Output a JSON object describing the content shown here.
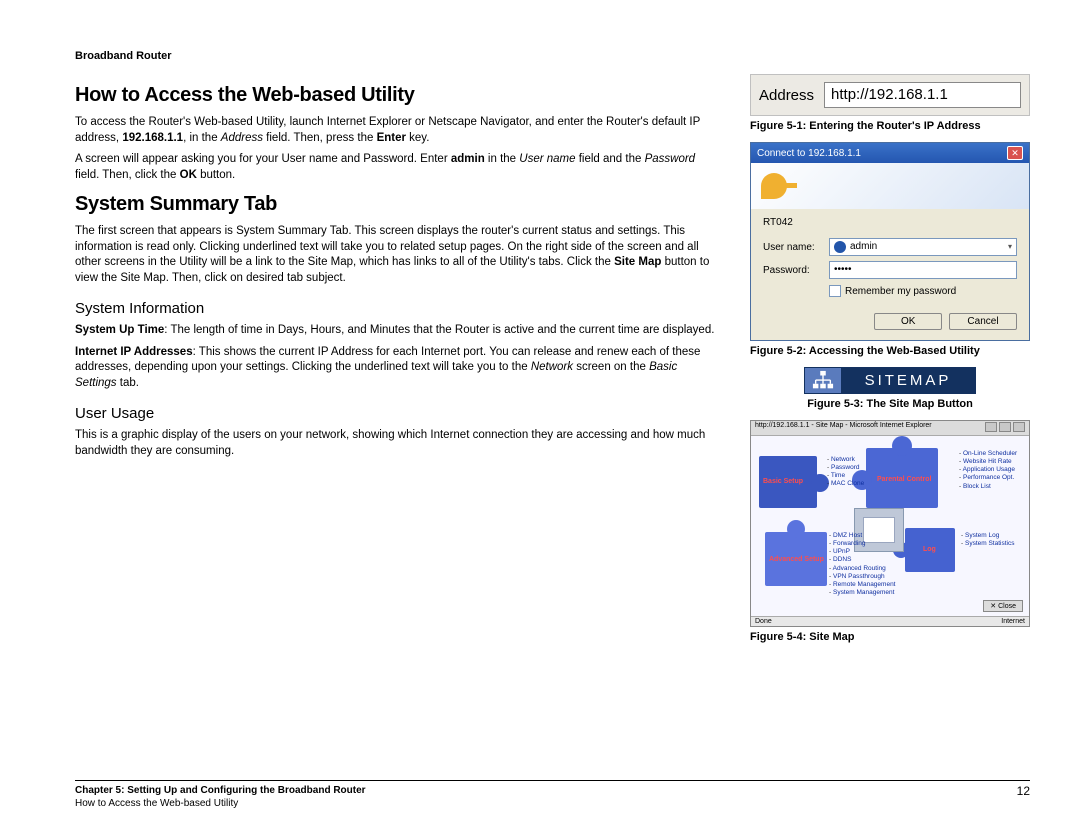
{
  "header": {
    "product": "Broadband Router"
  },
  "section1": {
    "title": "How to Access the Web-based Utility",
    "p1_a": "To access the Router's Web-based Utility, launch Internet Explorer or Netscape Navigator, and enter the Router's default IP address, ",
    "p1_ip": "192.168.1.1",
    "p1_b": ", in the ",
    "p1_addr": "Address",
    "p1_c": " field. Then, press the ",
    "p1_enter": "Enter",
    "p1_d": " key.",
    "p2_a": "A screen will appear asking you for your User name and Password. Enter ",
    "p2_admin": "admin",
    "p2_b": " in the ",
    "p2_user": "User name",
    "p2_c": " field and the ",
    "p2_pass": "Password",
    "p2_d": " field. Then, click the ",
    "p2_ok": "OK",
    "p2_e": " button."
  },
  "section2": {
    "title": "System Summary Tab",
    "p1_a": "The first screen that appears is System Summary Tab. This screen displays the router's current status and settings. This information is read only. Clicking underlined text will take you to related setup pages. On the right side of the screen and all other screens in the Utility will be a link to the Site Map, which has links to all of the Utility's tabs. Click the ",
    "p1_b": "Site Map",
    "p1_c": " button to view the Site Map. Then, click on desired tab subject.",
    "sub1": {
      "title": "System Information",
      "p1_a": "System Up Time",
      "p1_b": ": The length of time in Days, Hours, and Minutes that the Router is active and the current time are displayed.",
      "p2_a": "Internet IP Addresses",
      "p2_b": ": This shows the current IP Address for each Internet port. You can release and renew each of these addresses, depending upon your settings. Clicking the underlined text will take you to the ",
      "p2_c": "Network",
      "p2_d": " screen on the ",
      "p2_e": "Basic Settings",
      "p2_f": " tab."
    },
    "sub2": {
      "title": "User Usage",
      "p1": "This is a graphic display of the users on your network, showing which Internet connection they are accessing and how much bandwidth they are consuming."
    }
  },
  "figures": {
    "f1": {
      "caption": "Figure 5-1: Entering the Router's IP Address",
      "addr_label": "Address",
      "addr_value": "http://192.168.1.1"
    },
    "f2": {
      "caption": "Figure 5-2: Accessing the Web-Based Utility",
      "title": "Connect to 192.168.1.1",
      "server": "RT042",
      "user_label": "User name:",
      "user_value": "admin",
      "pass_label": "Password:",
      "pass_value": "•••••",
      "remember": "Remember my password",
      "ok": "OK",
      "cancel": "Cancel"
    },
    "f3": {
      "caption": "Figure 5-3: The Site Map Button",
      "label": "SITEMAP"
    },
    "f4": {
      "caption": "Figure 5-4: Site Map",
      "wintitle": "http://192.168.1.1 - Site Map - Microsoft Internet Explorer",
      "labels": {
        "basic": "Basic Setup",
        "parental": "Parental Control",
        "advanced": "Advanced Setup",
        "log": "Log"
      },
      "links": {
        "topL": [
          "Network",
          "Password",
          "Time",
          "MAC Clone"
        ],
        "topR": [
          "On-Line Scheduler",
          "Website Hit Rate",
          "Application Usage",
          "Performance Opt.",
          "Block List"
        ],
        "botL": [
          "DMZ Host",
          "Forwarding",
          "UPnP",
          "DDNS",
          "Advanced Routing",
          "VPN Passthrough",
          "Remote Management",
          "System Management"
        ],
        "botR": [
          "System Log",
          "System Statistics"
        ]
      },
      "close": "Close",
      "status_done": "Done",
      "status_net": "Internet"
    }
  },
  "footer": {
    "l1": "Chapter 5: Setting Up and Configuring the Broadband Router",
    "l2": "How to Access the Web-based Utility",
    "page": "12"
  }
}
